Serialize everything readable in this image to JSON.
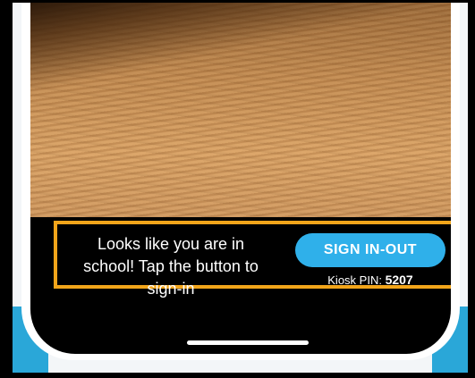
{
  "banner": {
    "message": "Looks like you are in school! Tap the button to sign-in",
    "button_label": "SIGN IN-OUT",
    "kiosk_pin_label": "Kiosk PIN:",
    "kiosk_pin_value": "5207"
  },
  "colors": {
    "highlight_border": "#f2a51a",
    "button": "#2fb0ea",
    "banner_background": "#000000",
    "background_accent": "#2aa7d8"
  }
}
